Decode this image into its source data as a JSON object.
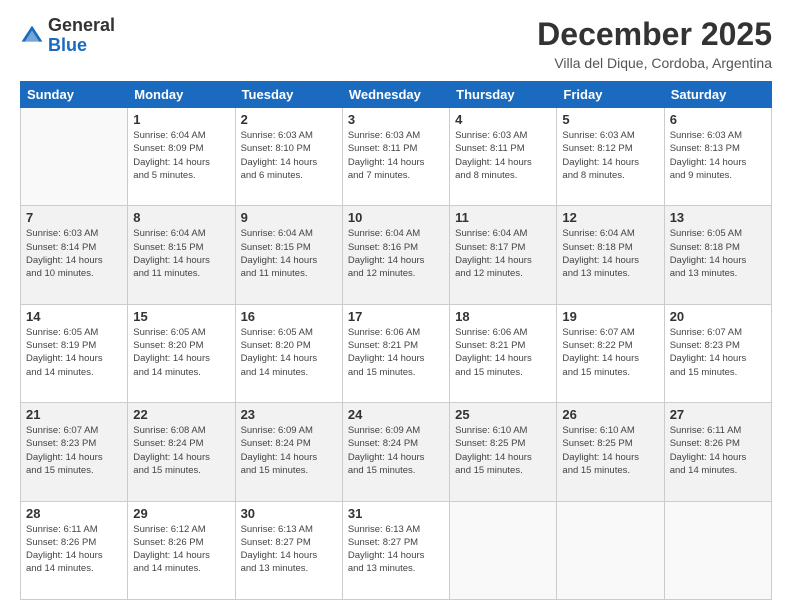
{
  "header": {
    "logo_general": "General",
    "logo_blue": "Blue",
    "month_title": "December 2025",
    "location": "Villa del Dique, Cordoba, Argentina"
  },
  "days_of_week": [
    "Sunday",
    "Monday",
    "Tuesday",
    "Wednesday",
    "Thursday",
    "Friday",
    "Saturday"
  ],
  "weeks": [
    [
      {
        "day": "",
        "info": ""
      },
      {
        "day": "1",
        "info": "Sunrise: 6:04 AM\nSunset: 8:09 PM\nDaylight: 14 hours\nand 5 minutes."
      },
      {
        "day": "2",
        "info": "Sunrise: 6:03 AM\nSunset: 8:10 PM\nDaylight: 14 hours\nand 6 minutes."
      },
      {
        "day": "3",
        "info": "Sunrise: 6:03 AM\nSunset: 8:11 PM\nDaylight: 14 hours\nand 7 minutes."
      },
      {
        "day": "4",
        "info": "Sunrise: 6:03 AM\nSunset: 8:11 PM\nDaylight: 14 hours\nand 8 minutes."
      },
      {
        "day": "5",
        "info": "Sunrise: 6:03 AM\nSunset: 8:12 PM\nDaylight: 14 hours\nand 8 minutes."
      },
      {
        "day": "6",
        "info": "Sunrise: 6:03 AM\nSunset: 8:13 PM\nDaylight: 14 hours\nand 9 minutes."
      }
    ],
    [
      {
        "day": "7",
        "info": "Sunrise: 6:03 AM\nSunset: 8:14 PM\nDaylight: 14 hours\nand 10 minutes."
      },
      {
        "day": "8",
        "info": "Sunrise: 6:04 AM\nSunset: 8:15 PM\nDaylight: 14 hours\nand 11 minutes."
      },
      {
        "day": "9",
        "info": "Sunrise: 6:04 AM\nSunset: 8:15 PM\nDaylight: 14 hours\nand 11 minutes."
      },
      {
        "day": "10",
        "info": "Sunrise: 6:04 AM\nSunset: 8:16 PM\nDaylight: 14 hours\nand 12 minutes."
      },
      {
        "day": "11",
        "info": "Sunrise: 6:04 AM\nSunset: 8:17 PM\nDaylight: 14 hours\nand 12 minutes."
      },
      {
        "day": "12",
        "info": "Sunrise: 6:04 AM\nSunset: 8:18 PM\nDaylight: 14 hours\nand 13 minutes."
      },
      {
        "day": "13",
        "info": "Sunrise: 6:05 AM\nSunset: 8:18 PM\nDaylight: 14 hours\nand 13 minutes."
      }
    ],
    [
      {
        "day": "14",
        "info": "Sunrise: 6:05 AM\nSunset: 8:19 PM\nDaylight: 14 hours\nand 14 minutes."
      },
      {
        "day": "15",
        "info": "Sunrise: 6:05 AM\nSunset: 8:20 PM\nDaylight: 14 hours\nand 14 minutes."
      },
      {
        "day": "16",
        "info": "Sunrise: 6:05 AM\nSunset: 8:20 PM\nDaylight: 14 hours\nand 14 minutes."
      },
      {
        "day": "17",
        "info": "Sunrise: 6:06 AM\nSunset: 8:21 PM\nDaylight: 14 hours\nand 15 minutes."
      },
      {
        "day": "18",
        "info": "Sunrise: 6:06 AM\nSunset: 8:21 PM\nDaylight: 14 hours\nand 15 minutes."
      },
      {
        "day": "19",
        "info": "Sunrise: 6:07 AM\nSunset: 8:22 PM\nDaylight: 14 hours\nand 15 minutes."
      },
      {
        "day": "20",
        "info": "Sunrise: 6:07 AM\nSunset: 8:23 PM\nDaylight: 14 hours\nand 15 minutes."
      }
    ],
    [
      {
        "day": "21",
        "info": "Sunrise: 6:07 AM\nSunset: 8:23 PM\nDaylight: 14 hours\nand 15 minutes."
      },
      {
        "day": "22",
        "info": "Sunrise: 6:08 AM\nSunset: 8:24 PM\nDaylight: 14 hours\nand 15 minutes."
      },
      {
        "day": "23",
        "info": "Sunrise: 6:09 AM\nSunset: 8:24 PM\nDaylight: 14 hours\nand 15 minutes."
      },
      {
        "day": "24",
        "info": "Sunrise: 6:09 AM\nSunset: 8:24 PM\nDaylight: 14 hours\nand 15 minutes."
      },
      {
        "day": "25",
        "info": "Sunrise: 6:10 AM\nSunset: 8:25 PM\nDaylight: 14 hours\nand 15 minutes."
      },
      {
        "day": "26",
        "info": "Sunrise: 6:10 AM\nSunset: 8:25 PM\nDaylight: 14 hours\nand 15 minutes."
      },
      {
        "day": "27",
        "info": "Sunrise: 6:11 AM\nSunset: 8:26 PM\nDaylight: 14 hours\nand 14 minutes."
      }
    ],
    [
      {
        "day": "28",
        "info": "Sunrise: 6:11 AM\nSunset: 8:26 PM\nDaylight: 14 hours\nand 14 minutes."
      },
      {
        "day": "29",
        "info": "Sunrise: 6:12 AM\nSunset: 8:26 PM\nDaylight: 14 hours\nand 14 minutes."
      },
      {
        "day": "30",
        "info": "Sunrise: 6:13 AM\nSunset: 8:27 PM\nDaylight: 14 hours\nand 13 minutes."
      },
      {
        "day": "31",
        "info": "Sunrise: 6:13 AM\nSunset: 8:27 PM\nDaylight: 14 hours\nand 13 minutes."
      },
      {
        "day": "",
        "info": ""
      },
      {
        "day": "",
        "info": ""
      },
      {
        "day": "",
        "info": ""
      }
    ]
  ]
}
